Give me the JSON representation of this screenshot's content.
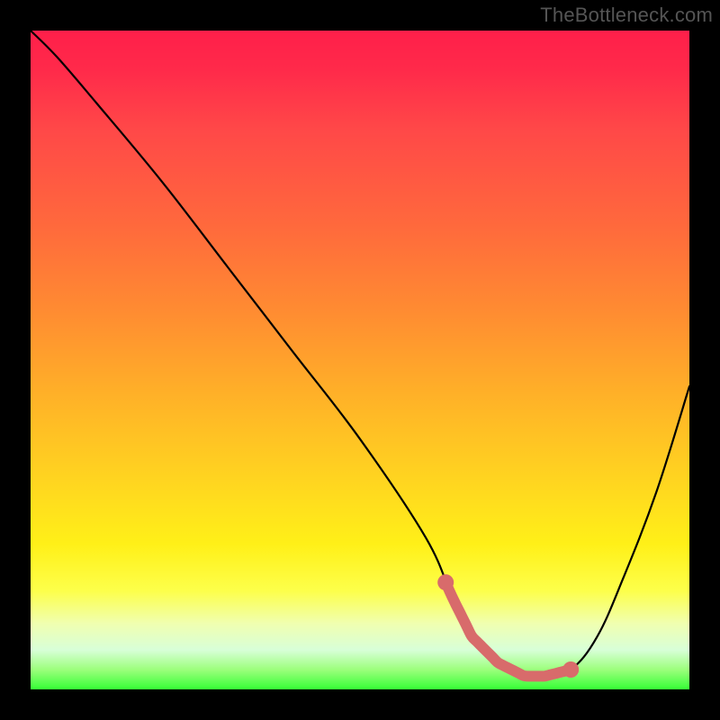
{
  "watermark": "TheBottleneck.com",
  "colors": {
    "frame_bg": "#000000",
    "gradient_top": "#ff1f4a",
    "gradient_mid": "#ffd420",
    "gradient_bottom": "#36ff36",
    "curve": "#000000",
    "highlight": "#d86b6b"
  },
  "chart_data": {
    "type": "line",
    "title": "",
    "xlabel": "",
    "ylabel": "",
    "xlim": [
      0,
      100
    ],
    "ylim": [
      0,
      100
    ],
    "grid": false,
    "legend": false,
    "series": [
      {
        "name": "bottleneck-curve",
        "x": [
          0,
          4,
          10,
          20,
          30,
          40,
          50,
          60,
          64,
          67,
          71,
          75,
          78,
          82,
          86,
          90,
          95,
          100
        ],
        "values": [
          100,
          96,
          89,
          77,
          64,
          51,
          38,
          23,
          14,
          8,
          4,
          2,
          2,
          3,
          8,
          17,
          30,
          46
        ]
      }
    ],
    "highlight_segment": {
      "x_start": 63,
      "x_end": 82,
      "note": "thick salmon-colored segment along the valley floor with dots at each end"
    }
  }
}
